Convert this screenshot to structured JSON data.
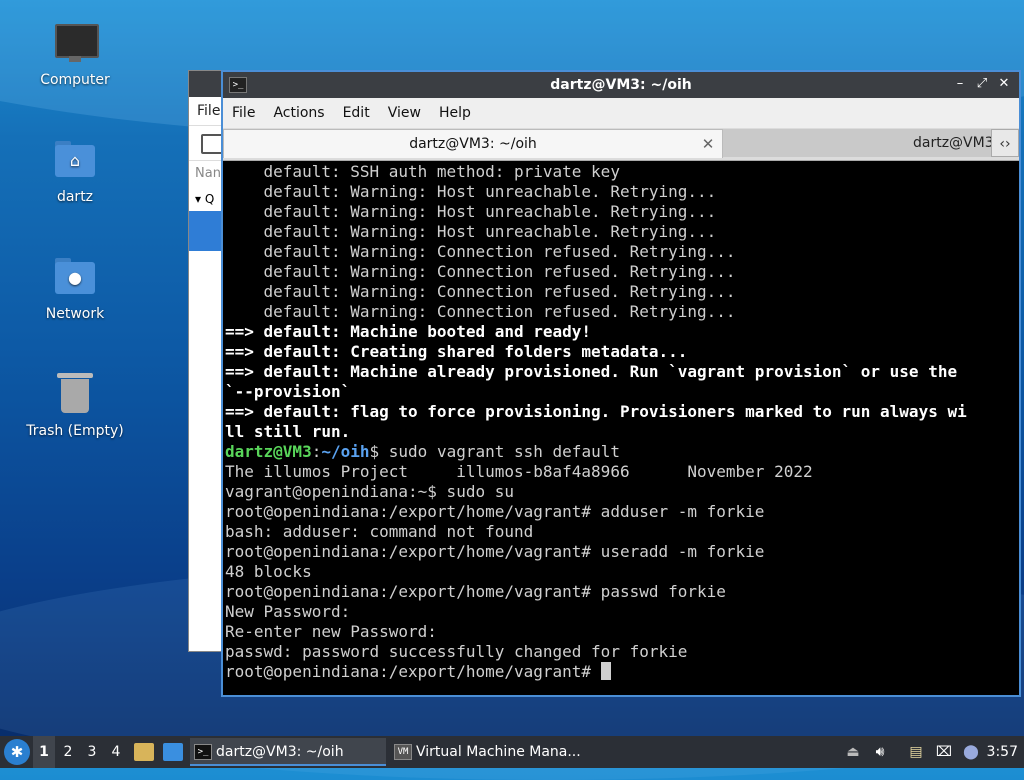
{
  "desktop": {
    "icons": [
      {
        "label": "Computer",
        "icon": "computer-icon"
      },
      {
        "label": "dartz",
        "icon": "home-folder-icon"
      },
      {
        "label": "Network",
        "icon": "network-folder-icon"
      },
      {
        "label": "Trash (Empty)",
        "icon": "trash-icon"
      }
    ]
  },
  "background_window": {
    "menu_first": "File",
    "column_header": "Nan",
    "group_row": "Q"
  },
  "terminal": {
    "title": "dartz@VM3: ~/oih",
    "menu": [
      "File",
      "Actions",
      "Edit",
      "View",
      "Help"
    ],
    "tabs": [
      {
        "label": "dartz@VM3: ~/oih",
        "active": true
      },
      {
        "label": "dartz@VM3",
        "active": false
      }
    ],
    "prompt_user": "dartz@VM3",
    "prompt_path": "~/oih",
    "lines": [
      {
        "text": "    default: SSH auth method: private key",
        "style": "normal"
      },
      {
        "text": "    default: Warning: Host unreachable. Retrying...",
        "style": "normal"
      },
      {
        "text": "    default: Warning: Host unreachable. Retrying...",
        "style": "normal"
      },
      {
        "text": "    default: Warning: Host unreachable. Retrying...",
        "style": "normal"
      },
      {
        "text": "    default: Warning: Connection refused. Retrying...",
        "style": "normal"
      },
      {
        "text": "    default: Warning: Connection refused. Retrying...",
        "style": "normal"
      },
      {
        "text": "    default: Warning: Connection refused. Retrying...",
        "style": "normal"
      },
      {
        "text": "    default: Warning: Connection refused. Retrying...",
        "style": "normal"
      },
      {
        "text": "==> default: Machine booted and ready!",
        "style": "bold"
      },
      {
        "text": "==> default: Creating shared folders metadata...",
        "style": "bold"
      },
      {
        "text": "==> default: Machine already provisioned. Run `vagrant provision` or use the",
        "style": "bold"
      },
      {
        "text": "`--provision`",
        "style": "bold"
      },
      {
        "text": "==> default: flag to force provisioning. Provisioners marked to run always wi",
        "style": "bold"
      },
      {
        "text": "ll still run.",
        "style": "bold"
      },
      {
        "text": "$ sudo vagrant ssh default",
        "style": "prompt"
      },
      {
        "text": "The illumos Project     illumos-b8af4a8966      November 2022",
        "style": "normal"
      },
      {
        "text": "vagrant@openindiana:~$ sudo su",
        "style": "normal"
      },
      {
        "text": "root@openindiana:/export/home/vagrant# adduser -m forkie",
        "style": "normal"
      },
      {
        "text": "bash: adduser: command not found",
        "style": "normal"
      },
      {
        "text": "root@openindiana:/export/home/vagrant# useradd -m forkie",
        "style": "normal"
      },
      {
        "text": "48 blocks",
        "style": "normal"
      },
      {
        "text": "root@openindiana:/export/home/vagrant# passwd forkie",
        "style": "normal"
      },
      {
        "text": "New Password:",
        "style": "normal"
      },
      {
        "text": "Re-enter new Password:",
        "style": "normal"
      },
      {
        "text": "passwd: password successfully changed for forkie",
        "style": "normal"
      },
      {
        "text": "root@openindiana:/export/home/vagrant# ",
        "style": "cursor"
      }
    ]
  },
  "taskbar": {
    "workspaces": [
      "1",
      "2",
      "3",
      "4"
    ],
    "active_workspace": "1",
    "tasks": [
      {
        "label": "dartz@VM3: ~/oih",
        "active": true
      },
      {
        "label": "Virtual Machine Mana...",
        "active": false
      }
    ],
    "clock": "3:57"
  },
  "colors": {
    "accent": "#4a8ed6",
    "prompt_user": "#59d65a",
    "prompt_path": "#5aa2f0"
  }
}
